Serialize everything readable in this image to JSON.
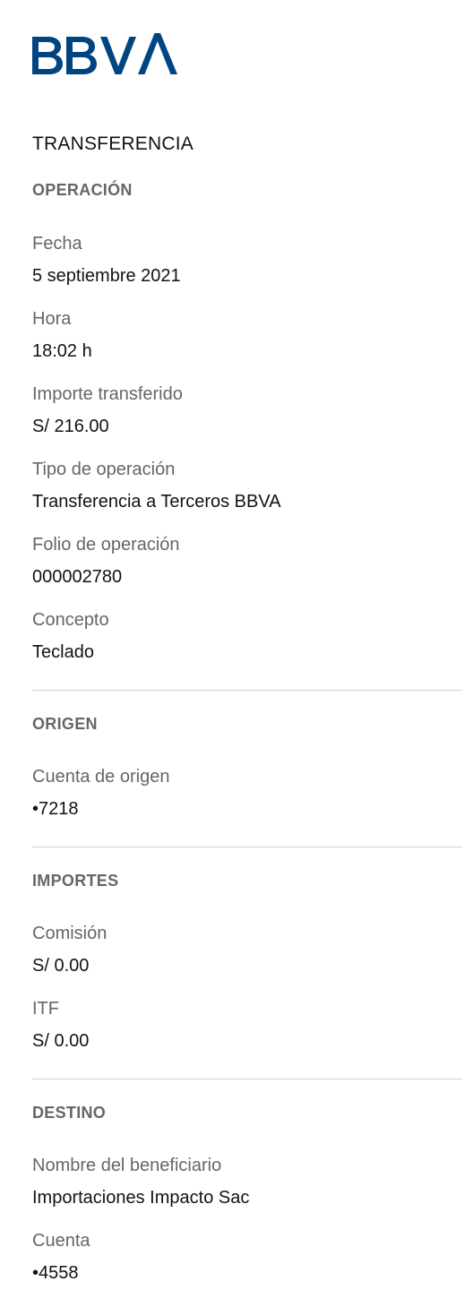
{
  "brand": {
    "logo_text": "BBVA",
    "color": "#004481"
  },
  "page": {
    "title": "TRANSFERENCIA"
  },
  "sections": {
    "operacion": {
      "title": "OPERACIÓN",
      "fecha_label": "Fecha",
      "fecha_value": "5 septiembre 2021",
      "hora_label": "Hora",
      "hora_value": "18:02 h",
      "importe_label": "Importe transferido",
      "importe_value": "S/ 216.00",
      "tipo_label": "Tipo de operación",
      "tipo_value": "Transferencia a Terceros BBVA",
      "folio_label": "Folio de operación",
      "folio_value": "000002780",
      "concepto_label": "Concepto",
      "concepto_value": "Teclado"
    },
    "origen": {
      "title": "ORIGEN",
      "cuenta_label": "Cuenta de origen",
      "cuenta_value": "•7218"
    },
    "importes": {
      "title": "IMPORTES",
      "comision_label": "Comisión",
      "comision_value": "S/ 0.00",
      "itf_label": "ITF",
      "itf_value": "S/ 0.00"
    },
    "destino": {
      "title": "DESTINO",
      "beneficiario_label": "Nombre del beneficiario",
      "beneficiario_value": "Importaciones Impacto Sac",
      "cuenta_label": "Cuenta",
      "cuenta_value": "•4558"
    }
  },
  "colors": {
    "text_primary": "#121212",
    "text_secondary": "#666666",
    "divider": "#d3d3d3"
  }
}
